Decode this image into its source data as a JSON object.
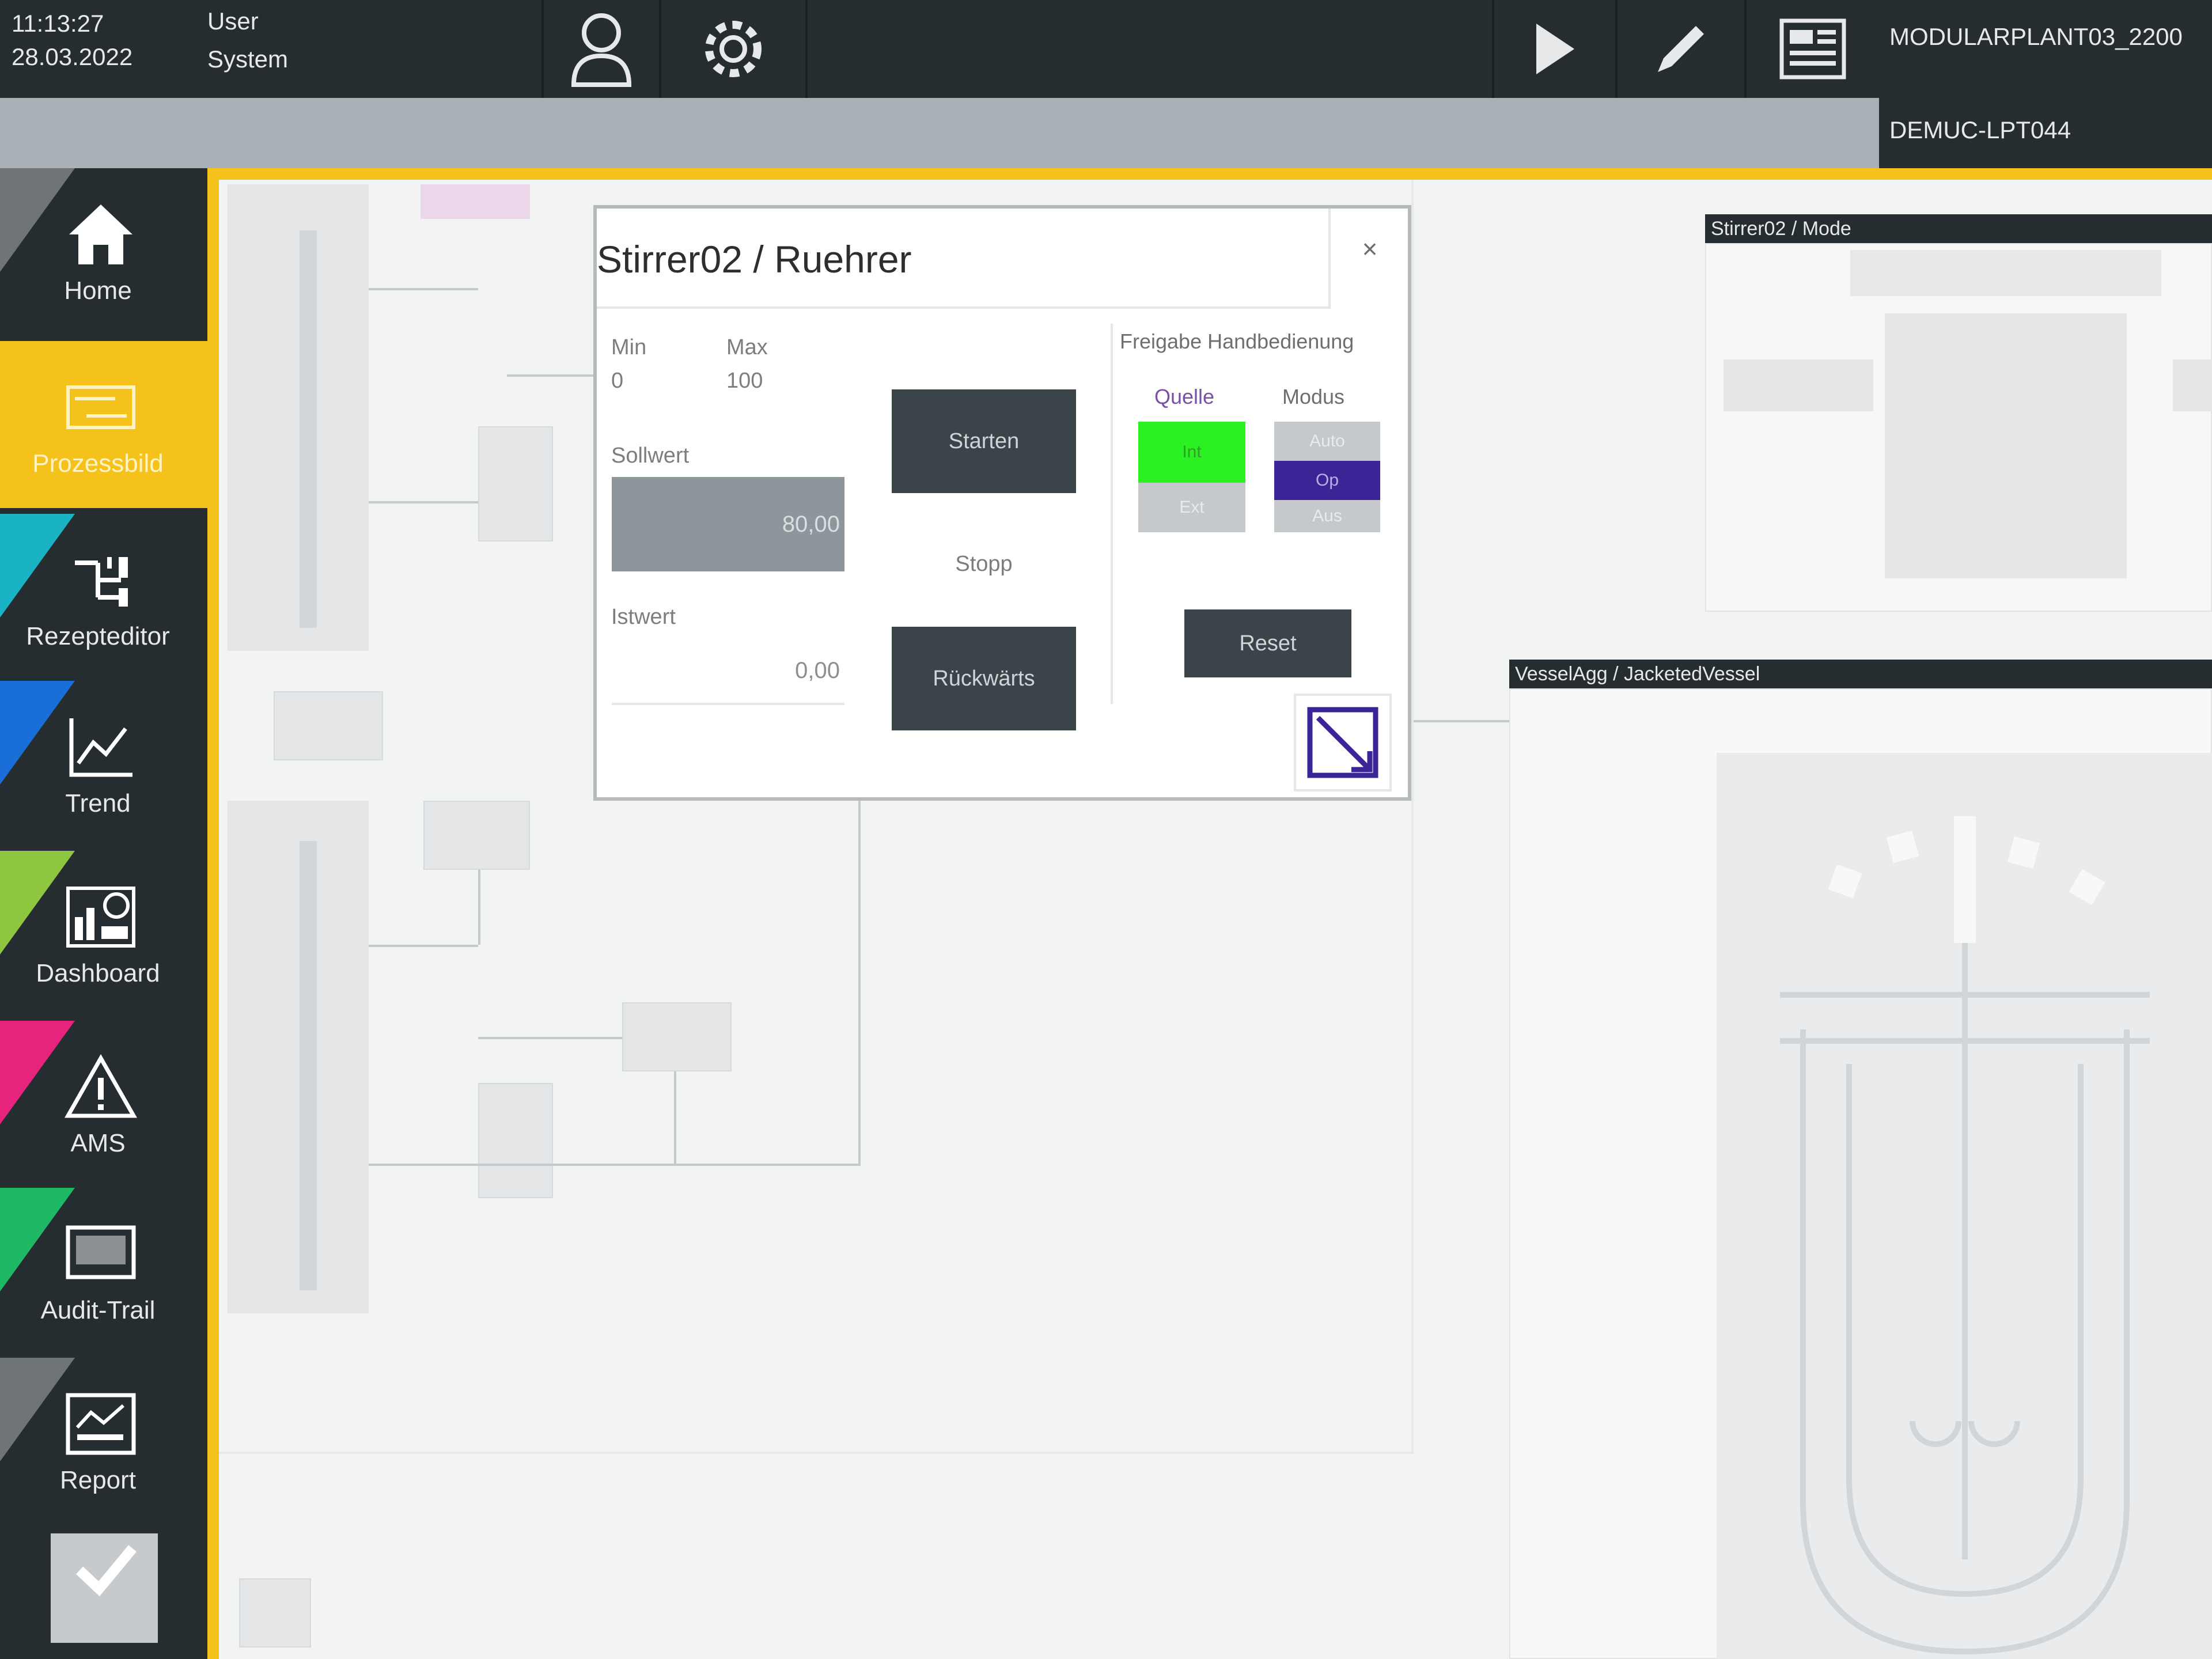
{
  "header": {
    "time": "11:13:27",
    "date": "28.03.2022",
    "user_label": "User",
    "user_value": "System",
    "plant_name": "MODULARPLANT03_2200",
    "station": "DEMUC-LPT044"
  },
  "sidebar": {
    "items": [
      {
        "label": "Home",
        "color": "#6e7478"
      },
      {
        "label": "Prozessbild",
        "color": "#f5c21c"
      },
      {
        "label": "Rezepteditor",
        "color": "#1ab3c4"
      },
      {
        "label": "Trend",
        "color": "#1a6ed8"
      },
      {
        "label": "Dashboard",
        "color": "#8ec63f"
      },
      {
        "label": "AMS",
        "color": "#e6247d"
      },
      {
        "label": "Audit-Trail",
        "color": "#1fb865"
      },
      {
        "label": "Report",
        "color": "#6e7478"
      }
    ]
  },
  "dialog": {
    "title": "Stirrer02 / Ruehrer",
    "close": "×",
    "min_label": "Min",
    "min_value": "0",
    "max_label": "Max",
    "max_value": "100",
    "setpoint_label": "Sollwert",
    "setpoint_value": "80,00",
    "actual_label": "Istwert",
    "actual_value": "0,00",
    "start_button": "Starten",
    "status_text": "Stopp",
    "reverse_button": "Rückwärts",
    "release_label": "Freigabe Handbedienung",
    "source_label": "Quelle",
    "mode_label": "Modus",
    "source_options": [
      "Int",
      "Ext"
    ],
    "mode_options": [
      "Auto",
      "Op",
      "Aus"
    ],
    "reset_button": "Reset"
  },
  "mini_faceplates": {
    "top_title": "Stirrer02 / Mode",
    "bottom_title": "VesselAgg / JacketedVessel"
  }
}
